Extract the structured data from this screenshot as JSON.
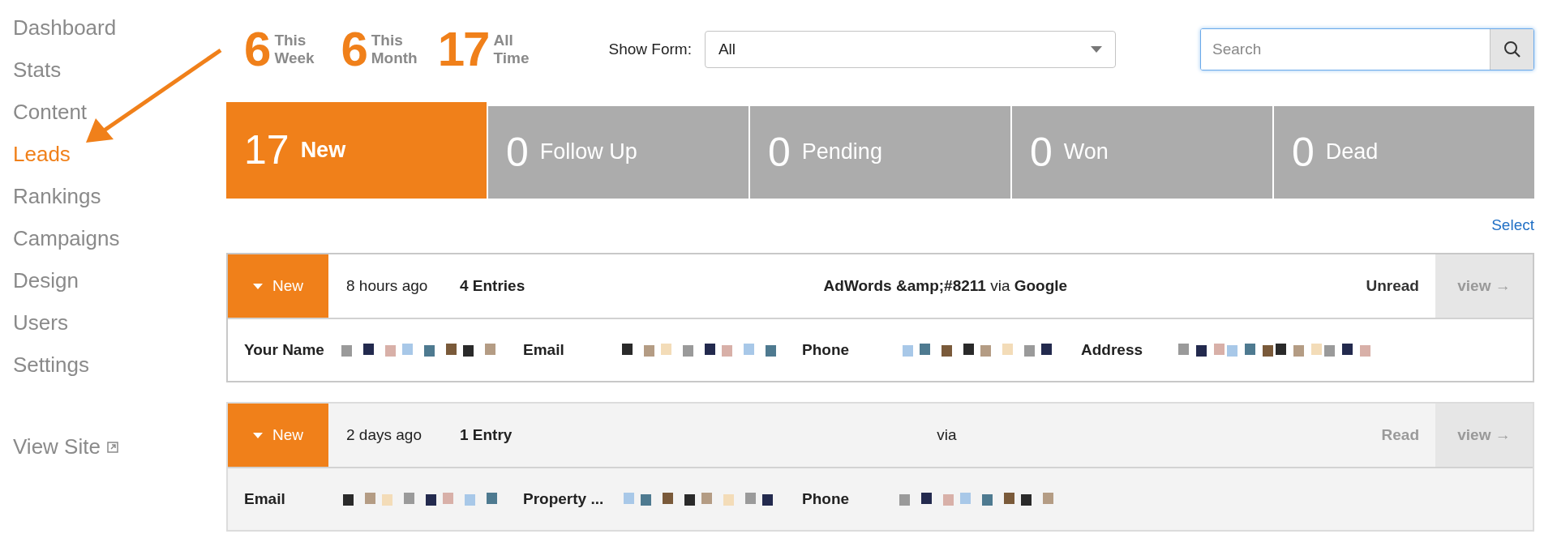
{
  "sidebar": {
    "items": [
      {
        "label": "Dashboard",
        "selected": false
      },
      {
        "label": "Stats",
        "selected": false
      },
      {
        "label": "Content",
        "selected": false
      },
      {
        "label": "Leads",
        "selected": true
      },
      {
        "label": "Rankings",
        "selected": false
      },
      {
        "label": "Campaigns",
        "selected": false
      },
      {
        "label": "Design",
        "selected": false
      },
      {
        "label": "Users",
        "selected": false
      },
      {
        "label": "Settings",
        "selected": false
      }
    ],
    "view_site": "View Site"
  },
  "summary": [
    {
      "count": "6",
      "label": "This Week"
    },
    {
      "count": "6",
      "label": "This Month"
    },
    {
      "count": "17",
      "label": "All Time"
    }
  ],
  "form_filter": {
    "label": "Show Form:",
    "value": "All"
  },
  "search": {
    "placeholder": "Search"
  },
  "status_tabs": [
    {
      "count": "17",
      "label": "New",
      "selected": true
    },
    {
      "count": "0",
      "label": "Follow Up",
      "selected": false
    },
    {
      "count": "0",
      "label": "Pending",
      "selected": false
    },
    {
      "count": "0",
      "label": "Won",
      "selected": false
    },
    {
      "count": "0",
      "label": "Dead",
      "selected": false
    }
  ],
  "select_link": "Select",
  "leads": [
    {
      "status": "New",
      "time": "8 hours ago",
      "entries": "4 Entries",
      "source": "**AdWords &amp;#8211** via **Google**",
      "read_state": "Unread",
      "read": false,
      "view": "view →",
      "fields": [
        {
          "label": "Your Name"
        },
        {
          "label": "Email"
        },
        {
          "label": "Phone"
        },
        {
          "label": "Address"
        }
      ]
    },
    {
      "status": "New",
      "time": "2 days ago",
      "entries": "1 Entry",
      "source": "via",
      "read_state": "Read",
      "read": true,
      "view": "view →",
      "fields": [
        {
          "label": "Email"
        },
        {
          "label": "Property ..."
        },
        {
          "label": "Phone"
        }
      ]
    }
  ]
}
